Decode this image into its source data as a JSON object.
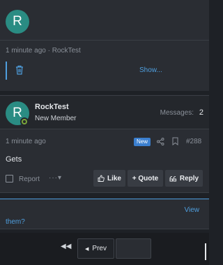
{
  "previous_post": {
    "avatar_letter": "R",
    "meta": "1 minute ago · RockTest",
    "show_more": "Show..."
  },
  "post": {
    "avatar_letter": "R",
    "username": "RockTest",
    "user_title": "New Member",
    "messages_label": "Messages:",
    "messages_count": "2",
    "time": "1 minute ago",
    "badge": "New",
    "post_number": "#288",
    "body": "Gets",
    "report_label": "Report",
    "more_label": "···▾",
    "actions": {
      "like": "Like",
      "quote": "+ Quote",
      "reply": "Reply"
    }
  },
  "quick_reply": {
    "view_label": "View",
    "them_label": "them?"
  },
  "pagination": {
    "first_glyph": "◀◀",
    "prev_glyph": "◀",
    "prev_label": "Prev"
  },
  "colors": {
    "accent": "#4f9fdf",
    "avatar": "#2a8c83",
    "badge_new": "#3b7fcf",
    "online": "#7aa63a"
  },
  "icons": {
    "trash": "trash-icon",
    "share": "share-icon",
    "bookmark": "bookmark-icon",
    "like": "thumbs-up-icon",
    "reply": "reply-icon",
    "first": "first-page-icon",
    "prev": "chevron-left-icon"
  }
}
